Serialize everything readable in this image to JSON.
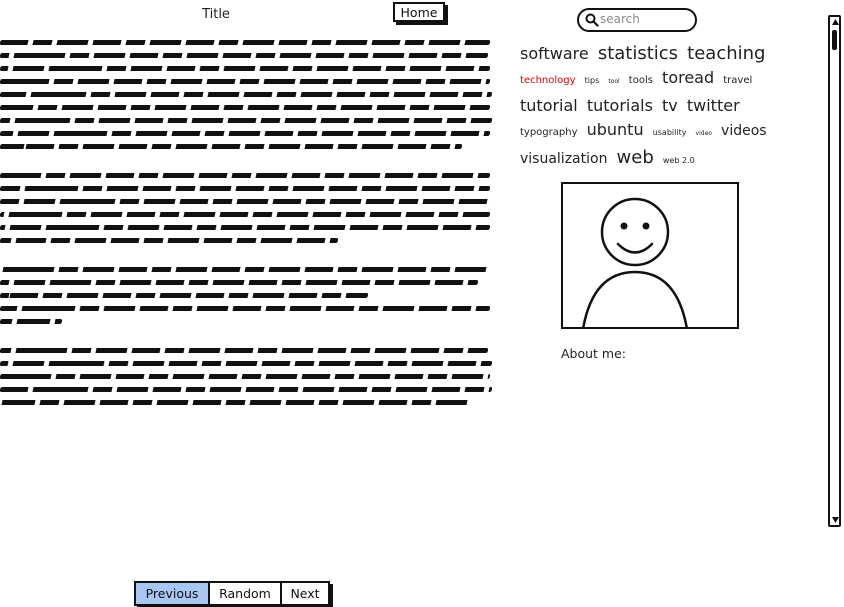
{
  "header": {
    "title": "Title",
    "home_label": "Home",
    "search": {
      "placeholder": "search",
      "value": ""
    }
  },
  "content": {
    "paragraphs": [
      {
        "lines": 9
      },
      {
        "lines": 6
      },
      {
        "lines": 5
      },
      {
        "lines": 5
      }
    ]
  },
  "tagcloud": [
    {
      "label": "software",
      "weight": 4
    },
    {
      "label": "statistics",
      "weight": 5
    },
    {
      "label": "teaching",
      "weight": 5
    },
    {
      "label": "technology",
      "weight": 2,
      "color": "#e00000"
    },
    {
      "label": "tips",
      "weight": 1
    },
    {
      "label": "tool",
      "weight": 0
    },
    {
      "label": "tools",
      "weight": 2
    },
    {
      "label": "toread",
      "weight": 4
    },
    {
      "label": "travel",
      "weight": 2
    },
    {
      "label": "tutorial",
      "weight": 4
    },
    {
      "label": "tutorials",
      "weight": 4
    },
    {
      "label": "tv",
      "weight": 4
    },
    {
      "label": "twitter",
      "weight": 4
    },
    {
      "label": "typography",
      "weight": 2
    },
    {
      "label": "ubuntu",
      "weight": 4
    },
    {
      "label": "usability",
      "weight": 1
    },
    {
      "label": "video",
      "weight": 0
    },
    {
      "label": "videos",
      "weight": 3
    },
    {
      "label": "visualization",
      "weight": 3
    },
    {
      "label": "web",
      "weight": 5
    },
    {
      "label": "web 2.0",
      "weight": 1
    }
  ],
  "sidebar": {
    "about_label": "About me:"
  },
  "pager": {
    "previous_label": "Previous",
    "random_label": "Random",
    "next_label": "Next",
    "active": "previous"
  },
  "icons": {
    "search": "search-icon",
    "avatar": "avatar-placeholder-icon",
    "scroll_up": "arrow-up-icon",
    "scroll_down": "arrow-down-icon"
  },
  "colors": {
    "accent": "#a9c7f3",
    "highlight_tag": "#e00000",
    "ink": "#111111"
  }
}
